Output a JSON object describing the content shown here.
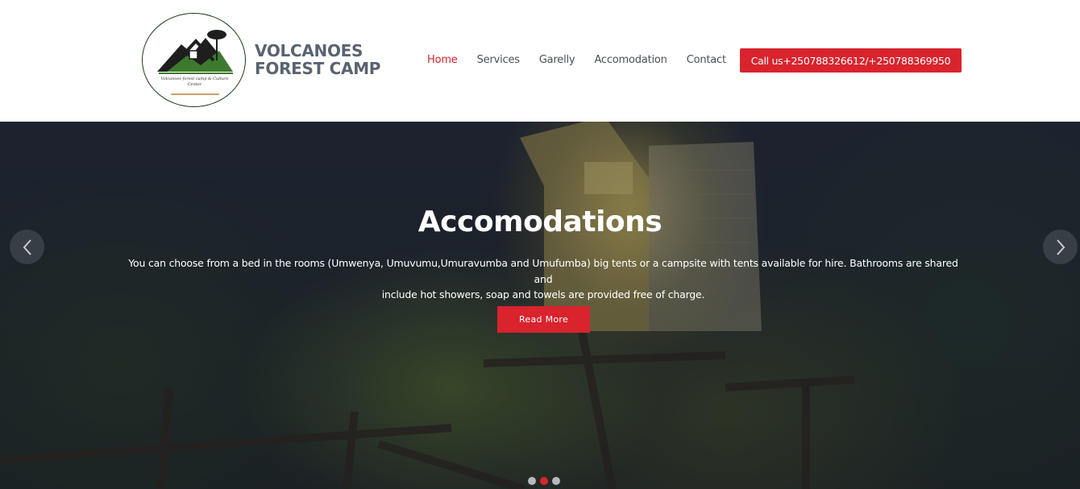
{
  "header": {
    "brand_line1": "VOLCANOES",
    "brand_line2": "FOREST CAMP",
    "logo_tagline": "Volcanoes forest camp & Culture Center",
    "nav": [
      {
        "label": "Home",
        "active": true
      },
      {
        "label": "Services",
        "active": false
      },
      {
        "label": "Garelly",
        "active": false
      },
      {
        "label": "Accomodation",
        "active": false
      },
      {
        "label": "Contact",
        "active": false
      }
    ],
    "call_label": "Call us+250788326612/+250788369950"
  },
  "hero": {
    "title": "Accomodations",
    "text_line1": "You can choose from a bed in the rooms (Umwenya, Umuvumu,Umuravumba and Umufumba) big tents or a campsite with tents available for hire. Bathrooms are shared and",
    "text_line2": "include hot showers, soap and towels are provided free of charge.",
    "button_label": "Read More",
    "prev_icon": "chevron-left-icon",
    "next_icon": "chevron-right-icon",
    "slides_total": 3,
    "active_slide": 2
  },
  "colors": {
    "accent": "#d9232d",
    "brand_text": "#5a6370",
    "nav_text": "#4a4f57"
  }
}
